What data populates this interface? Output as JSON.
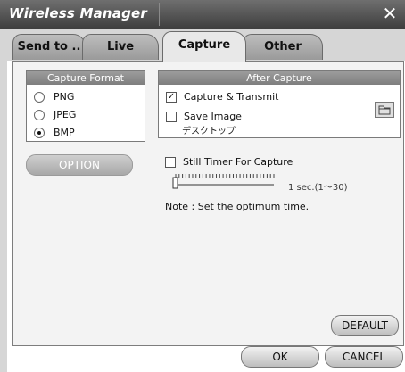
{
  "window": {
    "title": "Wireless Manager",
    "close_glyph": "✕"
  },
  "tabs": [
    {
      "label": "Send to ..",
      "active": false
    },
    {
      "label": "Live",
      "active": false
    },
    {
      "label": "Capture",
      "active": true
    },
    {
      "label": "Other",
      "active": false
    }
  ],
  "capture_format": {
    "title": "Capture Format",
    "options": [
      {
        "label": "PNG",
        "selected": false
      },
      {
        "label": "JPEG",
        "selected": false
      },
      {
        "label": "BMP",
        "selected": true
      }
    ],
    "option_button": "OPTION"
  },
  "after_capture": {
    "title": "After Capture",
    "capture_transmit": {
      "label": "Capture & Transmit",
      "checked": true
    },
    "save_image": {
      "label": "Save Image",
      "checked": false,
      "path": "デスクトップ"
    },
    "folder_icon": "folder-icon"
  },
  "timer": {
    "label": "Still Timer For Capture",
    "checked": false,
    "value_text": "1 sec.(1～30)",
    "slider_value": 1,
    "slider_min": 1,
    "slider_max": 30
  },
  "note": "Note : Set the optimum time.",
  "buttons": {
    "default": "DEFAULT",
    "ok": "OK",
    "cancel": "CANCEL"
  }
}
